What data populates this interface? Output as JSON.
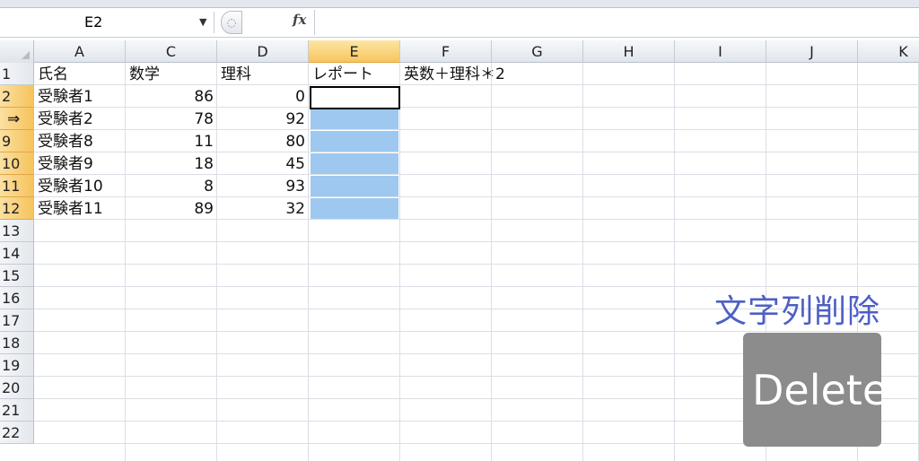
{
  "formula_bar": {
    "name_box": "E2",
    "dropdown_glyph": "▼",
    "cancel_glyph": "◌",
    "fx_label": "fx",
    "formula_value": ""
  },
  "columns": [
    "A",
    "C",
    "D",
    "E",
    "F",
    "G",
    "H",
    "I",
    "J",
    "K"
  ],
  "selected_column": "E",
  "rows": [
    {
      "header": "1",
      "cells": [
        "氏名",
        "数学",
        "理科",
        "レポート",
        "英数＋理科＊2"
      ]
    },
    {
      "header": "2",
      "cells": [
        "受験者1",
        "86",
        "0",
        "",
        ""
      ]
    },
    {
      "header": "⇒",
      "cells": [
        "受験者2",
        "78",
        "92",
        "",
        ""
      ]
    },
    {
      "header": "9",
      "cells": [
        "受験者8",
        "11",
        "80",
        "",
        ""
      ]
    },
    {
      "header": "10",
      "cells": [
        "受験者9",
        "18",
        "45",
        "",
        ""
      ]
    },
    {
      "header": "11",
      "cells": [
        "受験者10",
        "8",
        "93",
        "",
        ""
      ]
    },
    {
      "header": "12",
      "cells": [
        "受験者11",
        "89",
        "32",
        "",
        ""
      ]
    },
    {
      "header": "13",
      "cells": []
    },
    {
      "header": "14",
      "cells": []
    },
    {
      "header": "15",
      "cells": []
    },
    {
      "header": "16",
      "cells": []
    },
    {
      "header": "17",
      "cells": []
    },
    {
      "header": "18",
      "cells": []
    },
    {
      "header": "19",
      "cells": []
    },
    {
      "header": "20",
      "cells": []
    },
    {
      "header": "21",
      "cells": []
    },
    {
      "header": "22",
      "cells": []
    }
  ],
  "overlay": {
    "caption": "文字列削除",
    "key_label": "Delete"
  },
  "colors": {
    "selection_fill": "#9ec8ef",
    "header_selected": "#f7c55e",
    "caption": "#4d5fc4",
    "key_bg": "#8c8c8c"
  }
}
